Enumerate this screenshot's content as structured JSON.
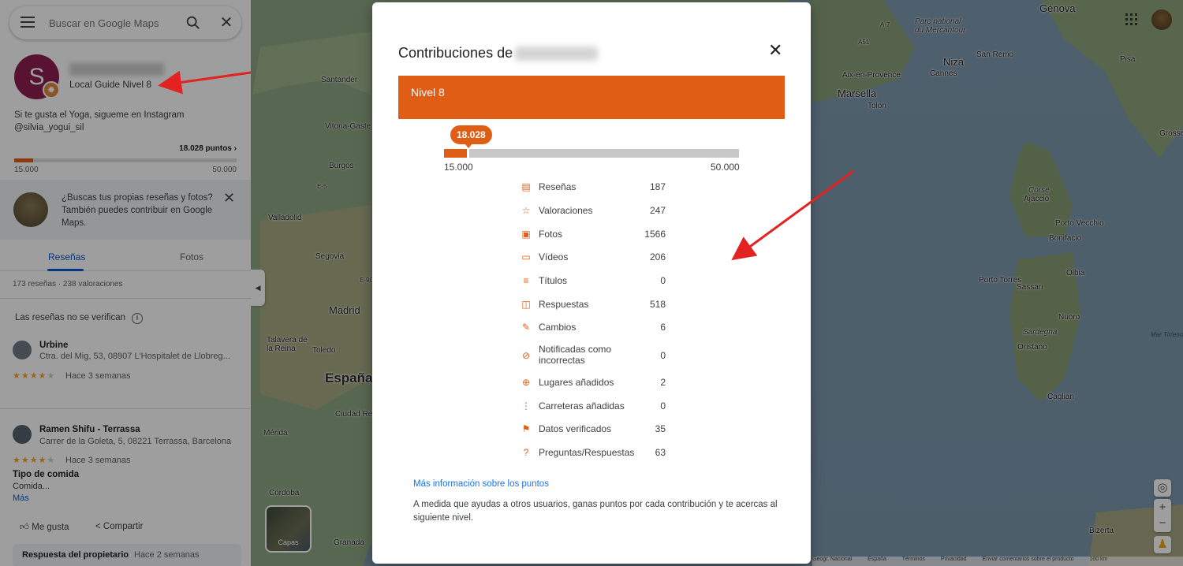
{
  "search": {
    "placeholder": "Buscar en Google Maps"
  },
  "profile": {
    "avatar_letter": "S",
    "level_text": "Local Guide Nivel 8",
    "bio_line1": "Si te gusta el Yoga, sigueme en Instagram",
    "bio_line2": "@silvia_yogui_sil",
    "points_text": "18.028 puntos",
    "range_min": "15.000",
    "range_max": "50.000",
    "progress_fraction": 0.0865
  },
  "tip": {
    "text": "¿Buscas tus propias reseñas y fotos? También puedes contribuir en Google Maps."
  },
  "tabs": [
    {
      "label": "Reseñas",
      "active": true
    },
    {
      "label": "Fotos",
      "active": false
    }
  ],
  "review_counts": "173 reseñas · 238 valoraciones",
  "verify_text": "Las reseñas no se verifican",
  "reviews": [
    {
      "name": "Urbine",
      "address": "Ctra. del Mig, 53, 08907 L'Hospitalet de Llobreg...",
      "rating": 4,
      "time": "Hace 3 semanas"
    },
    {
      "name": "Ramen Shifu - Terrassa",
      "address": "Carrer de la Goleta, 5, 08221 Terrassa, Barcelona",
      "rating": 4,
      "time": "Hace 3 semanas",
      "food_label": "Tipo de comida",
      "food_value": "Comida...",
      "more": "Más"
    }
  ],
  "actions": {
    "like": "Me gusta",
    "share": "Compartir"
  },
  "owner": {
    "title": "Respuesta del propietario",
    "time": "Hace 2 semanas"
  },
  "map": {
    "layers_label": "Capas",
    "labels": {
      "genova": "Génova",
      "parc": "Parc national du Mercantour",
      "nice": "Niza",
      "sanremo": "San Remo",
      "aix": "Aix-en-Provence",
      "cannes": "Cannes",
      "marsella": "Marsella",
      "tolon": "Tolon",
      "pisa": "Pisa",
      "grosse": "Grosse",
      "corse": "Corse",
      "ajaccio": "Ajaccio",
      "porto": "Porto Vecchio",
      "bonifacio": "Bonifacio",
      "sassari": "Sassari",
      "olbia": "Olbia",
      "porto_torres": "Porto Torres",
      "nuoro": "Nuoro",
      "sardegna": "Sardegna",
      "oristano": "Oristano",
      "mar_tirreno": "Mar Tirreno",
      "cagliari": "Cagliari",
      "bizerta": "Bizerta",
      "santander": "Santander",
      "vitoria": "Vitoria-Gaste",
      "burgos": "Burgos",
      "valladolid": "Valladolid",
      "segovia": "Segovia",
      "madrid": "Madrid",
      "talavera": "Talavera de la Reina",
      "toledo": "Toledo",
      "espana": "España",
      "ciudad_real": "Ciudad Real",
      "merida": "Mérida",
      "cordoba": "Córdoba",
      "granada": "Granada",
      "a7": "A-7",
      "a51": "A51",
      "e5": "E-5",
      "e90": "E-90"
    },
    "footer": [
      "Geogr. Nacional",
      "España",
      "Términos",
      "Privacidad",
      "Enviar comentarios sobre el producto",
      "100 km"
    ]
  },
  "modal": {
    "title": "Contribuciones de",
    "level": "Nivel 8",
    "points_tag": "18.028",
    "range_min": "15.000",
    "range_max": "50.000",
    "progress_fraction": 0.0865,
    "stats": [
      {
        "icon": "review-icon",
        "label": "Reseñas",
        "value": "187"
      },
      {
        "icon": "star-icon",
        "label": "Valoraciones",
        "value": "247"
      },
      {
        "icon": "photo-icon",
        "label": "Fotos",
        "value": "1566"
      },
      {
        "icon": "video-icon",
        "label": "Vídeos",
        "value": "206"
      },
      {
        "icon": "caption-icon",
        "label": "Títulos",
        "value": "0"
      },
      {
        "icon": "answer-icon",
        "label": "Respuestas",
        "value": "518"
      },
      {
        "icon": "edit-icon",
        "label": "Cambios",
        "value": "6"
      },
      {
        "icon": "report-icon",
        "label": "Notificadas como incorrectas",
        "value": "0"
      },
      {
        "icon": "add-place-icon",
        "label": "Lugares añadidos",
        "value": "2"
      },
      {
        "icon": "road-icon",
        "label": "Carreteras añadidas",
        "value": "0"
      },
      {
        "icon": "flag-icon",
        "label": "Datos verificados",
        "value": "35"
      },
      {
        "icon": "qa-icon",
        "label": "Preguntas/Respuestas",
        "value": "63"
      }
    ],
    "link": "Más información sobre los puntos",
    "description": "A medida que ayudas a otros usuarios, ganas puntos por cada contribución y te acercas al siguiente nivel."
  },
  "colors": {
    "accent": "#e05d16",
    "link": "#1a73e8",
    "tab_active": "#0b57d0"
  }
}
